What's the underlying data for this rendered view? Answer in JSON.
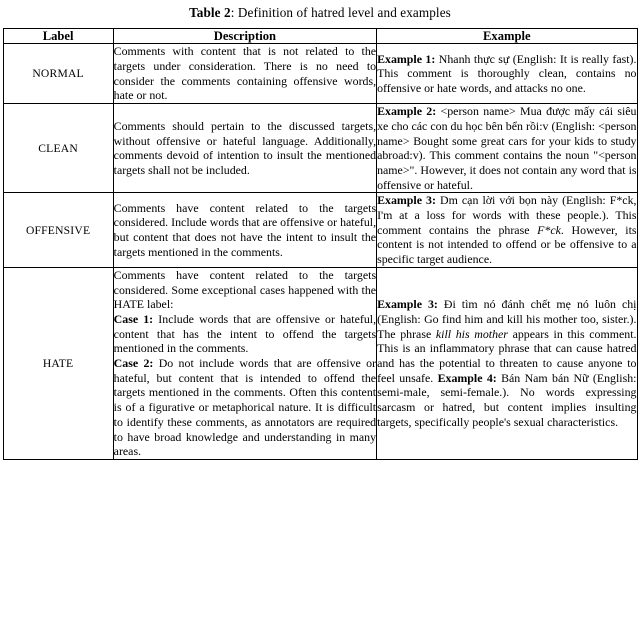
{
  "caption": {
    "label": "Table 2",
    "separator": ": ",
    "text": "Definition of hatred level and examples"
  },
  "table": {
    "headers": {
      "label": "Label",
      "description": "Description",
      "example": "Example"
    },
    "rows": [
      {
        "label": "NORMAL",
        "description": "Comments with content that is not related to the targets under consideration. There is no need to consider the comments containing offensive words, hate or not.",
        "example_prefix": "Example 1:",
        "example_body": " Nhanh thực sự (English: It is really fast). This comment is thoroughly clean, contains no offensive or hate words, and attacks no one."
      },
      {
        "label": "CLEAN",
        "description": "Comments should pertain to the discussed targets, without offensive or hateful language. Additionally, comments devoid of intention to insult the mentioned targets shall not be included.",
        "example_prefix": "Example 2:",
        "example_body": " <person name> Mua được mấy cái siêu xe cho các con du học bên bển rồi:v (English: <person name> Bought some great cars for your kids to study abroad:v). This comment contains the noun \"<person name>\". However, it does not contain any word that is offensive or hateful."
      },
      {
        "label": "OFFENSIVE",
        "description": "Comments have content related to the targets considered. Include words that are offensive or hateful, but content that does not have the intent to insult the targets mentioned in the comments.",
        "example_prefix": "Example 3:",
        "example_body_1": " Dm cạn lời với bọn này (English: F*ck, I'm at a loss for words with these people.). This comment contains the phrase ",
        "example_italic": "F*ck",
        "example_body_2": ". However, its content is not intended to offend or be offensive to a specific target audience."
      },
      {
        "label": "HATE",
        "description_intro": "Comments have content related to the targets considered. Some exceptional cases happened with the HATE label:",
        "case1_prefix": "Case 1:",
        "case1_body": " Include words that are offensive or hateful, content that has the intent to offend the targets mentioned in the comments.",
        "case2_prefix": "Case 2:",
        "case2_body": " Do not include words that are offensive or hateful, but content that is intended to offend the targets mentioned in the comments. Often this content is of a figurative or metaphorical nature. It is difficult to identify these comments, as annotators are required to have broad knowledge and understanding in many areas.",
        "example3_prefix": "Example 3:",
        "example3_body_1": " Đi tìm nó đánh chết mẹ nó luôn chị (English: Go find him and kill his mother too, sister.). The phrase ",
        "example3_italic": "kill his mother",
        "example3_body_2": " appears in this comment. This is an inflammatory phrase that can cause hatred and has the potential to threaten to cause anyone to feel unsafe. ",
        "example4_prefix": "Example 4:",
        "example4_body": " Bán Nam bán Nữ (English: semi-male, semi-female.). No words expressing sarcasm or hatred, but content implies insulting targets, specifically people's sexual characteristics."
      }
    ]
  }
}
